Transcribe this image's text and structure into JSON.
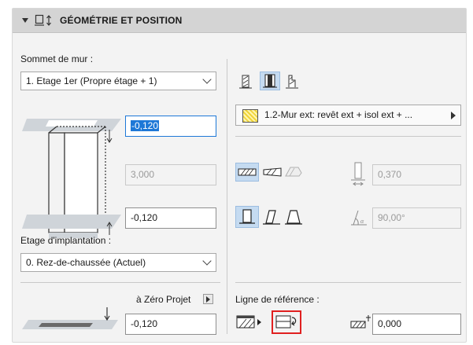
{
  "header": {
    "title": "GÉOMÉTRIE ET POSITION"
  },
  "left": {
    "top_label": "Sommet de mur :",
    "top_select": "1. Etage 1er (Propre étage + 1)",
    "top_offset": "-0,120",
    "height": "3,000",
    "bottom_offset": "-0,120",
    "home_label": "Etage d'implantation :",
    "home_select": "0. Rez-de-chaussée (Actuel)",
    "zero_label": "à Zéro Projet",
    "zero_value": "-0,120"
  },
  "right": {
    "composite": "1.2-Mur ext: revêt ext + isol ext + ...",
    "thickness": "0,370",
    "angle": "90,00°",
    "ref_label": "Ligne de référence :",
    "ref_offset": "0,000"
  }
}
